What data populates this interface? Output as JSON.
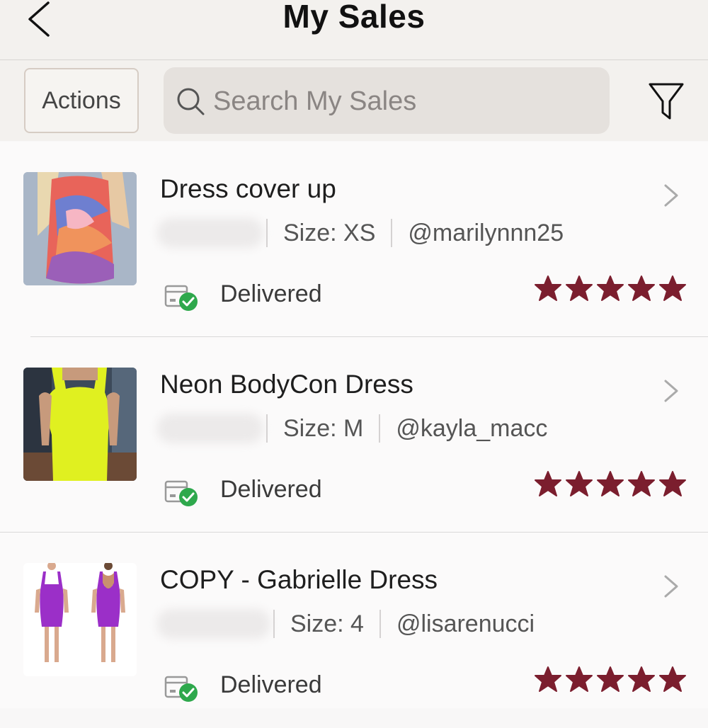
{
  "header": {
    "title": "My Sales",
    "back_icon": "chevron-left-icon"
  },
  "toolbar": {
    "actions_label": "Actions",
    "search_placeholder": "Search My Sales",
    "search_value": "",
    "search_icon": "search-icon",
    "filter_icon": "filter-icon"
  },
  "colors": {
    "star": "#7b1e2e",
    "delivered_check": "#2ea84c",
    "header_bg": "#f3f1ee"
  },
  "sales": [
    {
      "title": "Dress cover up",
      "size": "Size: XS",
      "buyer": "@marilynnn25",
      "status": "Delivered",
      "rating": 5,
      "thumb": "swirl-print-dress"
    },
    {
      "title": "Neon BodyCon Dress",
      "size": "Size: M",
      "buyer": "@kayla_macc",
      "status": "Delivered",
      "rating": 5,
      "thumb": "neon-yellow-dress"
    },
    {
      "title": "COPY - Gabrielle Dress",
      "size": "Size: 4",
      "buyer": "@lisarenucci",
      "status": "Delivered",
      "rating": 5,
      "thumb": "purple-dress"
    }
  ]
}
